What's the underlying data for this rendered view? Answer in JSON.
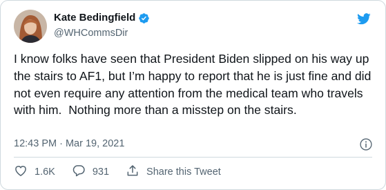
{
  "author": {
    "name": "Kate Bedingfield",
    "handle": "@WHCommsDir",
    "verified_icon": "verified-badge-icon",
    "avatar_icon": "avatar"
  },
  "brand": {
    "icon": "twitter-bird-icon",
    "color": "#1d9bf0"
  },
  "tweet": {
    "text": "I know folks have seen that President Biden slipped on his way up the stairs to AF1, but I’m happy to report that he is just fine and did not even require any attention from the medical team who travels with him.  Nothing more than a misstep on the stairs.",
    "timestamp": "12:43 PM · Mar 19, 2021"
  },
  "actions": {
    "like_count": "1.6K",
    "reply_count": "931",
    "share_label": "Share this Tweet"
  }
}
